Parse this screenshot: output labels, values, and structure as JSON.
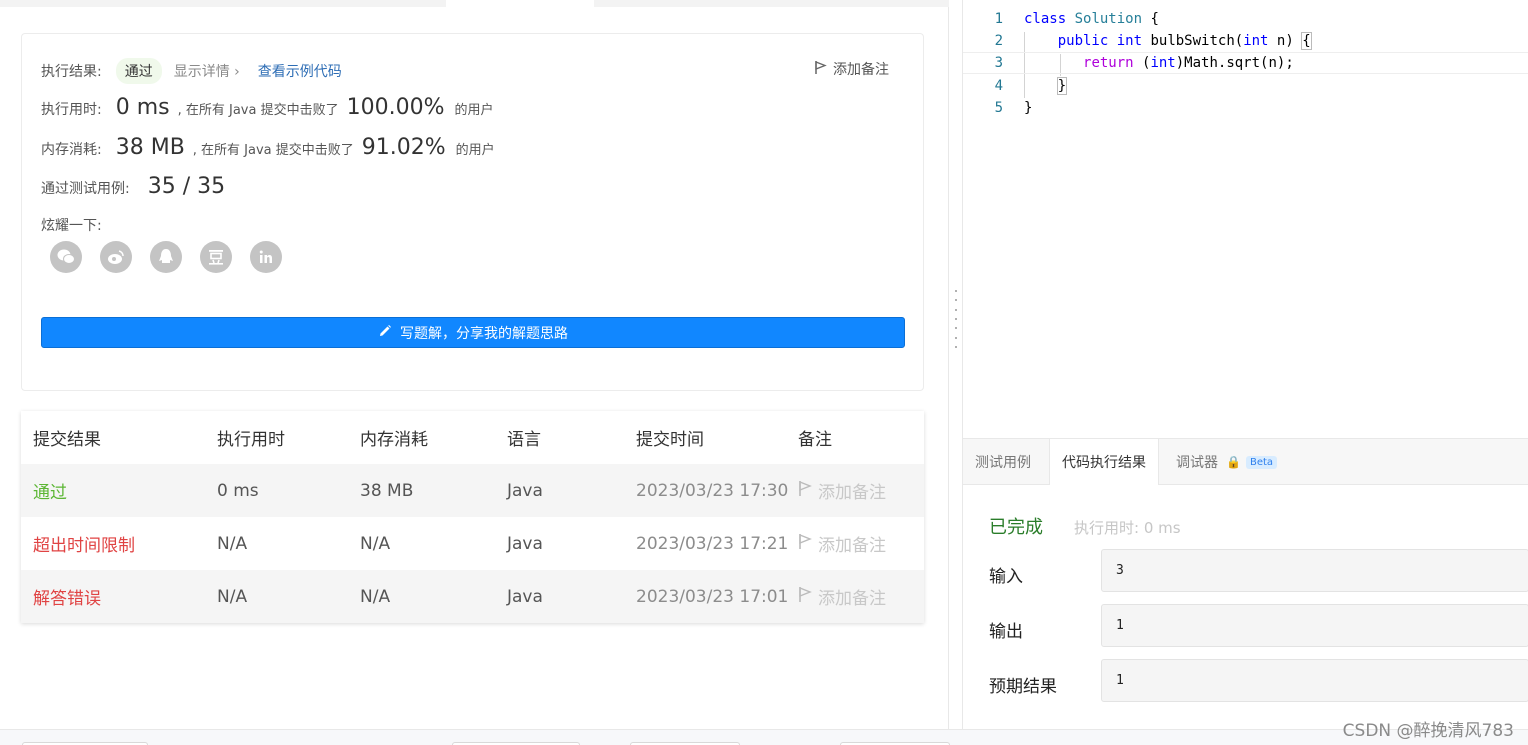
{
  "result": {
    "exec_result_label": "执行结果:",
    "status": "通过",
    "show_details": "显示详情 ›",
    "view_example": "查看示例代码",
    "add_note": "添加备注",
    "runtime_label": "执行用时:",
    "runtime_value": "0 ms",
    "beat_text": ", 在所有 Java 提交中击败了",
    "runtime_pct": "100.00%",
    "users_suffix": "的用户",
    "memory_label": "内存消耗:",
    "memory_value": "38 MB",
    "memory_pct": "91.02%",
    "tests_label": "通过测试用例:",
    "tests_value": "35 / 35",
    "share_label": "炫耀一下:",
    "share_icons": [
      "wechat-icon",
      "weibo-icon",
      "qq-icon",
      "douban-icon",
      "linkedin-icon"
    ],
    "write_solution": "写题解，分享我的解题思路"
  },
  "submissions": {
    "headers": [
      "提交结果",
      "执行用时",
      "内存消耗",
      "语言",
      "提交时间",
      "备注"
    ],
    "rows": [
      {
        "status": "通过",
        "runtime": "0 ms",
        "memory": "38 MB",
        "lang": "Java",
        "time": "2023/03/23 17:30",
        "note": "添加备注"
      },
      {
        "status": "超出时间限制",
        "runtime": "N/A",
        "memory": "N/A",
        "lang": "Java",
        "time": "2023/03/23 17:21",
        "note": "添加备注"
      },
      {
        "status": "解答错误",
        "runtime": "N/A",
        "memory": "N/A",
        "lang": "Java",
        "time": "2023/03/23 17:01",
        "note": "添加备注"
      }
    ]
  },
  "editor": {
    "line_numbers": [
      "1",
      "2",
      "3",
      "4",
      "5"
    ]
  },
  "console": {
    "tabs": [
      "测试用例",
      "代码执行结果",
      "调试器"
    ],
    "beta": "Beta",
    "done": "已完成",
    "exec_time": "执行用时: 0 ms",
    "input_label": "输入",
    "input_value": "3",
    "output_label": "输出",
    "output_value": "1",
    "expected_label": "预期结果",
    "expected_value": "1"
  },
  "watermark": "CSDN @醉挽清风783",
  "colors": {
    "pass": "#5cb634",
    "fail": "#e04343",
    "primary_button": "#1187ff"
  }
}
